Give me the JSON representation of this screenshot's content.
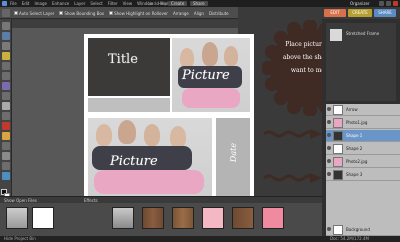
{
  "menubar": {
    "menus": [
      "File",
      "Edit",
      "Image",
      "Enhance",
      "Layer",
      "Select",
      "Filter",
      "View",
      "Window",
      "Help"
    ],
    "undo_label": "Undo",
    "redo_label": "Redo",
    "create_label": "Create",
    "share_label": "Share",
    "organizer_label": "Organizer"
  },
  "options_bar": {
    "options": [
      "Auto Select Layer",
      "Show Bounding Box",
      "Show Highlight on Rollover",
      "Arrange",
      "Align",
      "Distribute"
    ]
  },
  "document": {
    "tab_title": "Title layout Design Learning Template.psd @ 16.4% (RGB/8)"
  },
  "canvas": {
    "title_text": "Title",
    "picture_text_top": "Picture",
    "picture_text_bottom": "Picture",
    "side_text": "Date"
  },
  "note": {
    "text": "Place picture layer above the shape you want to merge."
  },
  "panel": {
    "tabs": [
      "EDIT",
      "CREATE",
      "SHARE"
    ],
    "layers": [
      {
        "name": "Stretched Frame",
        "selected": false
      },
      {
        "name": "Arrow",
        "selected": false
      },
      {
        "name": "Photo1.jpg",
        "selected": false
      },
      {
        "name": "Shape 1",
        "selected": true
      },
      {
        "name": "Shape 2",
        "selected": false
      },
      {
        "name": "Photo2.jpg",
        "selected": false
      },
      {
        "name": "Shape 3",
        "selected": false
      },
      {
        "name": "Background",
        "selected": false
      }
    ]
  },
  "bin": {
    "label": "Show Open Files",
    "dropdown": "Effects",
    "items": [
      "photo-1",
      "photo-2",
      "wood-1",
      "wood-2",
      "pink-1",
      "pink-2",
      "wood-3",
      "pink-3"
    ]
  },
  "status": {
    "left": "Hide Project Bin",
    "right": "Doc: 54.2M/172.4M"
  },
  "colors": {
    "accent": "#d9704a",
    "note_bg": "#3f2a24",
    "layer_selected": "#6a95c9"
  }
}
